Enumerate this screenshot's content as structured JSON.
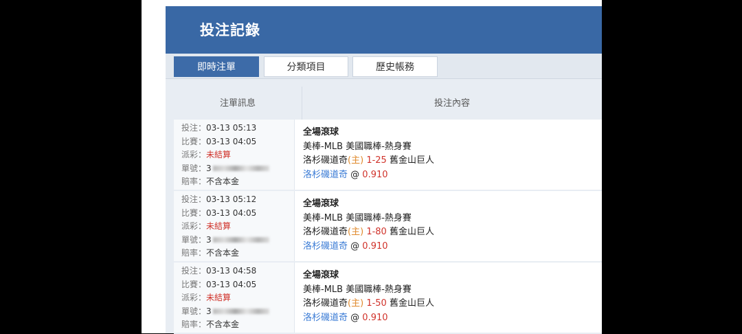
{
  "header": {
    "title": "投注記錄"
  },
  "tabs": [
    {
      "label": "即時注單",
      "active": true
    },
    {
      "label": "分類項目",
      "active": false
    },
    {
      "label": "歷史帳務",
      "active": false
    }
  ],
  "table": {
    "headers": {
      "info": "注單訊息",
      "content": "投注內容"
    },
    "labels": {
      "bet_time": "投注：",
      "match_time": "比賽：",
      "payout": "派彩：",
      "ticket": "單號：",
      "odds_type": "賠率："
    },
    "rows": [
      {
        "bet_time": "03-13 05:13",
        "match_time": "03-13 04:05",
        "payout": "未結算",
        "ticket_prefix": "3",
        "odds_type": "不含本金",
        "market": "全場滾球",
        "league": "美棒-MLB 美國職棒-熱身賽",
        "home": "洛杉磯道奇",
        "home_tag": "(主)",
        "line": "1-25",
        "away": "舊金山巨人",
        "pick": "洛杉磯道奇",
        "at": "@",
        "odds": "0.910"
      },
      {
        "bet_time": "03-13 05:12",
        "match_time": "03-13 04:05",
        "payout": "未結算",
        "ticket_prefix": "3",
        "odds_type": "不含本金",
        "market": "全場滾球",
        "league": "美棒-MLB 美國職棒-熱身賽",
        "home": "洛杉磯道奇",
        "home_tag": "(主)",
        "line": "1-80",
        "away": "舊金山巨人",
        "pick": "洛杉磯道奇",
        "at": "@",
        "odds": "0.910"
      },
      {
        "bet_time": "03-13 04:58",
        "match_time": "03-13 04:05",
        "payout": "未結算",
        "ticket_prefix": "3",
        "odds_type": "不含本金",
        "market": "全場滾球",
        "league": "美棒-MLB 美國職棒-熱身賽",
        "home": "洛杉磯道奇",
        "home_tag": "(主)",
        "line": "1-50",
        "away": "舊金山巨人",
        "pick": "洛杉磯道奇",
        "at": "@",
        "odds": "0.910"
      }
    ]
  }
}
